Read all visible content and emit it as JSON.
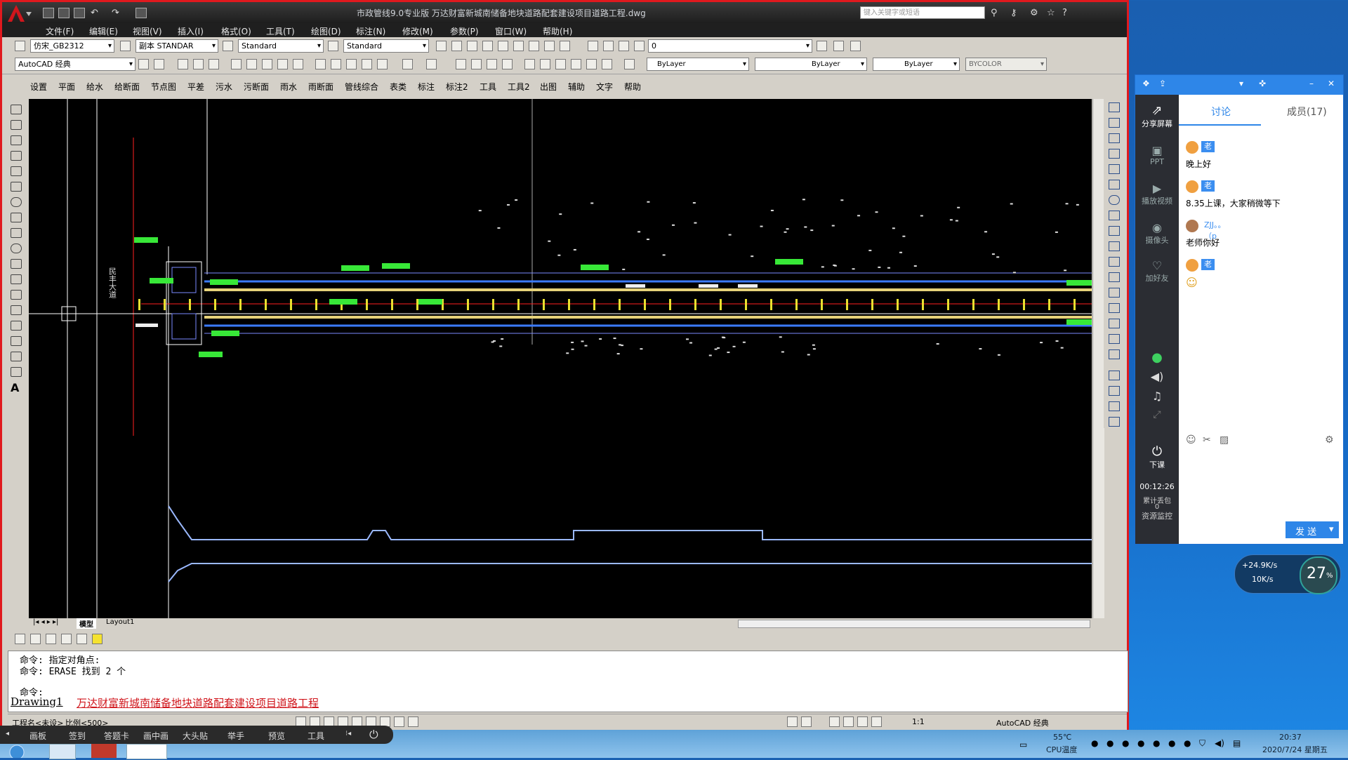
{
  "cad": {
    "window_title": "市政管线9.0专业版    万达财富新城南储备地块道路配套建设项目道路工程.dwg",
    "search_placeholder": "键入关键字或短语",
    "menu": [
      "文件(F)",
      "编辑(E)",
      "视图(V)",
      "插入(I)",
      "格式(O)",
      "工具(T)",
      "绘图(D)",
      "标注(N)",
      "修改(M)",
      "参数(P)",
      "窗口(W)",
      "帮助(H)"
    ],
    "toolbar1": {
      "text_style": "仿宋_GB2312",
      "dim_style": "副本 STANDAR",
      "table_style": "Standard",
      "multileader_style": "Standard",
      "layer": "0"
    },
    "toolbar2": {
      "workspace": "AutoCAD 经典",
      "color": "ByLayer",
      "linetype": "ByLayer",
      "lineweight": "ByLayer",
      "plotstyle": "BYCOLOR"
    },
    "custom_menu": [
      "设置",
      "平面",
      "给水",
      "给断面",
      "节点图",
      "平差",
      "污水",
      "污断面",
      "雨水",
      "雨断面",
      "管线综合",
      "表类",
      "标注",
      "标注2",
      "工具",
      "工具2",
      "出图",
      "辅助",
      "文字",
      "帮助"
    ],
    "drawing_vertical_label": "民丰大道",
    "tabs": [
      "模型",
      "Layout1"
    ],
    "command_lines": [
      "命令: 指定对角点:",
      "命令:  ERASE 找到 2 个",
      "命令:"
    ],
    "drawing_tabs": [
      "Drawing1",
      "万达财富新城南储备地块道路配套建设项目道路工程"
    ],
    "status": {
      "project": "工程名<未设>",
      "scale": "比例<500>",
      "anno_scale": "1:1",
      "workspace": "AutoCAD 经典"
    }
  },
  "taskbar": {
    "apps": [
      "画板",
      "签到",
      "答题卡",
      "画中画",
      "大头贴",
      "举手",
      "预览",
      "工具"
    ],
    "cpu_temp": "55℃",
    "cpu_label": "CPU温度",
    "time": "20:37",
    "date": "2020/7/24 星期五"
  },
  "chat": {
    "tabs": [
      "讨论",
      "成员(17)"
    ],
    "side_items": [
      "分享屏幕",
      "PPT",
      "播放视频",
      "摄像头",
      "加好友",
      "下课"
    ],
    "class_timer": "00:12:26",
    "side_extra": [
      "累计丢包",
      "0",
      "资源监控"
    ],
    "messages": [
      {
        "name": "老师",
        "text": "晚上好"
      },
      {
        "name": "老师",
        "text": "8.35上课，大家稍微等下"
      },
      {
        "name": "ZJJ。。（p",
        "text": "老师你好"
      },
      {
        "name": "老师",
        "text": ""
      }
    ],
    "send_label": "发 送"
  },
  "net": {
    "up": "+24.9K/s",
    "down": "10K/s",
    "percent": "27",
    "unit": "%"
  },
  "colors": {
    "accent": "#2e86e8",
    "cad_border": "#e0191e",
    "pipe_blue": "#3b7bff",
    "pipe_yellow": "#e6d27a",
    "label_green": "#38e838"
  }
}
